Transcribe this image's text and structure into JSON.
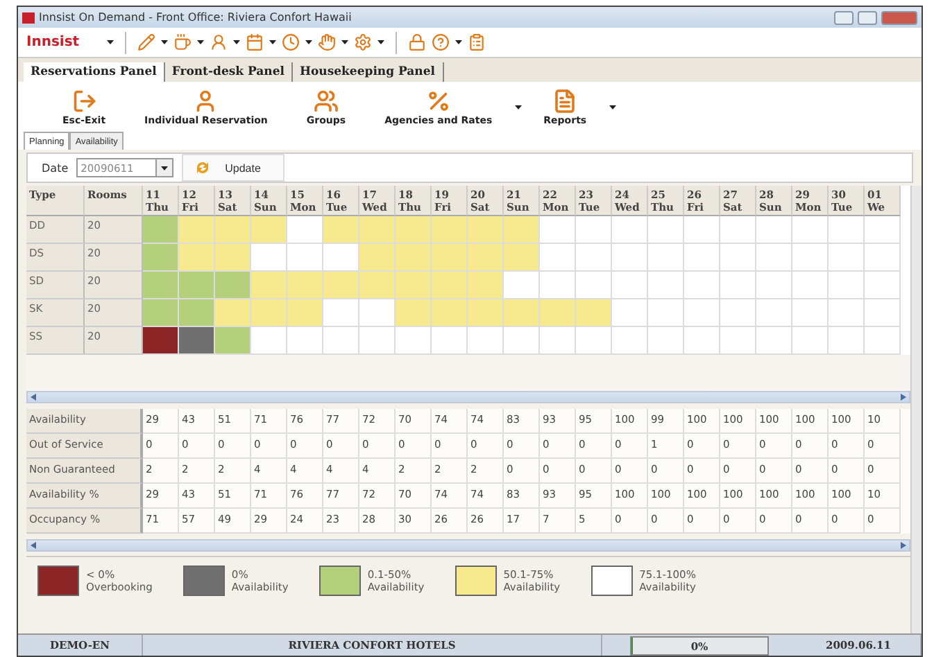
{
  "window": {
    "title": "Innsist On Demand - Front Office: Riviera Confort Hawaii"
  },
  "toolbar": {
    "logo": "Innsist"
  },
  "panel_tabs": [
    {
      "label": "Reservations Panel",
      "selected": true
    },
    {
      "label": "Front-desk Panel",
      "selected": false
    },
    {
      "label": "Housekeeping Panel",
      "selected": false
    }
  ],
  "ribbon": [
    {
      "kind": "exit",
      "label": "Esc-Exit",
      "has_menu": false
    },
    {
      "kind": "person",
      "label": "Individual Reservation",
      "has_menu": false
    },
    {
      "kind": "group",
      "label": "Groups",
      "has_menu": false
    },
    {
      "kind": "rates",
      "label": "Agencies and Rates",
      "has_menu": true
    },
    {
      "kind": "reports",
      "label": "Reports",
      "has_menu": true
    }
  ],
  "sub_tabs": [
    {
      "label": "Planning",
      "selected": true
    },
    {
      "label": "Availability",
      "selected": false
    }
  ],
  "date_bar": {
    "label": "Date",
    "value": "20090611",
    "button": "Update"
  },
  "planning": {
    "type_header": "Type",
    "rooms_header": "Rooms",
    "columns": [
      {
        "day": "11",
        "weekday": "Thu"
      },
      {
        "day": "12",
        "weekday": "Fri"
      },
      {
        "day": "13",
        "weekday": "Sat"
      },
      {
        "day": "14",
        "weekday": "Sun"
      },
      {
        "day": "15",
        "weekday": "Mon"
      },
      {
        "day": "16",
        "weekday": "Tue"
      },
      {
        "day": "17",
        "weekday": "Wed"
      },
      {
        "day": "18",
        "weekday": "Thu"
      },
      {
        "day": "19",
        "weekday": "Fri"
      },
      {
        "day": "20",
        "weekday": "Sat"
      },
      {
        "day": "21",
        "weekday": "Sun"
      },
      {
        "day": "22",
        "weekday": "Mon"
      },
      {
        "day": "23",
        "weekday": "Tue"
      },
      {
        "day": "24",
        "weekday": "Wed"
      },
      {
        "day": "25",
        "weekday": "Thu"
      },
      {
        "day": "26",
        "weekday": "Fri"
      },
      {
        "day": "27",
        "weekday": "Sat"
      },
      {
        "day": "28",
        "weekday": "Sun"
      },
      {
        "day": "29",
        "weekday": "Mon"
      },
      {
        "day": "30",
        "weekday": "Tue"
      },
      {
        "day": "01",
        "weekday": "We"
      }
    ],
    "rows": [
      {
        "type": "DD",
        "rooms": "20",
        "cells": [
          {
            "color": "#b5d07c"
          },
          {
            "color": "#f6e98e"
          },
          {
            "color": "#f6e98e"
          },
          {
            "color": "#f6e98e"
          },
          {
            "color": "#ffffff"
          },
          {
            "color": "#f6e98e"
          },
          {
            "color": "#f6e98e"
          },
          {
            "color": "#f6e98e"
          },
          {
            "color": "#f6e98e"
          },
          {
            "color": "#f6e98e"
          },
          {
            "color": "#f6e98e"
          },
          {
            "color": "#ffffff"
          },
          {
            "color": "#ffffff"
          },
          {
            "color": "#ffffff"
          },
          {
            "color": "#ffffff"
          },
          {
            "color": "#ffffff"
          },
          {
            "color": "#ffffff"
          },
          {
            "color": "#ffffff"
          },
          {
            "color": "#ffffff"
          },
          {
            "color": "#ffffff"
          },
          {
            "color": "#ffffff"
          }
        ]
      },
      {
        "type": "DS",
        "rooms": "20",
        "cells": [
          {
            "color": "#b5d07c"
          },
          {
            "color": "#f6e98e"
          },
          {
            "color": "#f6e98e"
          },
          {
            "color": "#ffffff"
          },
          {
            "color": "#ffffff"
          },
          {
            "color": "#ffffff"
          },
          {
            "color": "#f6e98e"
          },
          {
            "color": "#f6e98e"
          },
          {
            "color": "#f6e98e"
          },
          {
            "color": "#f6e98e"
          },
          {
            "color": "#f6e98e"
          },
          {
            "color": "#ffffff"
          },
          {
            "color": "#ffffff"
          },
          {
            "color": "#ffffff"
          },
          {
            "color": "#ffffff"
          },
          {
            "color": "#ffffff"
          },
          {
            "color": "#ffffff"
          },
          {
            "color": "#ffffff"
          },
          {
            "color": "#ffffff"
          },
          {
            "color": "#ffffff"
          },
          {
            "color": "#ffffff"
          }
        ]
      },
      {
        "type": "SD",
        "rooms": "20",
        "cells": [
          {
            "color": "#b5d07c"
          },
          {
            "color": "#b5d07c"
          },
          {
            "color": "#b5d07c"
          },
          {
            "color": "#f6e98e"
          },
          {
            "color": "#f6e98e"
          },
          {
            "color": "#f6e98e"
          },
          {
            "color": "#f6e98e"
          },
          {
            "color": "#f6e98e"
          },
          {
            "color": "#f6e98e"
          },
          {
            "color": "#f6e98e"
          },
          {
            "color": "#ffffff"
          },
          {
            "color": "#ffffff"
          },
          {
            "color": "#ffffff"
          },
          {
            "color": "#ffffff"
          },
          {
            "color": "#ffffff"
          },
          {
            "color": "#ffffff"
          },
          {
            "color": "#ffffff"
          },
          {
            "color": "#ffffff"
          },
          {
            "color": "#ffffff"
          },
          {
            "color": "#ffffff"
          },
          {
            "color": "#ffffff"
          }
        ]
      },
      {
        "type": "SK",
        "rooms": "20",
        "cells": [
          {
            "color": "#b5d07c"
          },
          {
            "color": "#b5d07c"
          },
          {
            "color": "#f6e98e"
          },
          {
            "color": "#f6e98e"
          },
          {
            "color": "#f6e98e"
          },
          {
            "color": "#ffffff"
          },
          {
            "color": "#ffffff"
          },
          {
            "color": "#f6e98e"
          },
          {
            "color": "#f6e98e"
          },
          {
            "color": "#f6e98e"
          },
          {
            "color": "#f6e98e"
          },
          {
            "color": "#f6e98e"
          },
          {
            "color": "#f6e98e"
          },
          {
            "color": "#ffffff"
          },
          {
            "color": "#ffffff"
          },
          {
            "color": "#ffffff"
          },
          {
            "color": "#ffffff"
          },
          {
            "color": "#ffffff"
          },
          {
            "color": "#ffffff"
          },
          {
            "color": "#ffffff"
          },
          {
            "color": "#ffffff"
          }
        ]
      },
      {
        "type": "SS",
        "rooms": "20",
        "cells": [
          {
            "color": "#8b2526"
          },
          {
            "color": "#707070"
          },
          {
            "color": "#b5d07c"
          },
          {
            "color": "#ffffff"
          },
          {
            "color": "#ffffff"
          },
          {
            "color": "#ffffff"
          },
          {
            "color": "#ffffff"
          },
          {
            "color": "#ffffff"
          },
          {
            "color": "#ffffff"
          },
          {
            "color": "#ffffff"
          },
          {
            "color": "#ffffff"
          },
          {
            "color": "#ffffff"
          },
          {
            "color": "#ffffff"
          },
          {
            "color": "#ffffff"
          },
          {
            "color": "#ffffff"
          },
          {
            "color": "#ffffff"
          },
          {
            "color": "#ffffff"
          },
          {
            "color": "#ffffff"
          },
          {
            "color": "#ffffff"
          },
          {
            "color": "#ffffff"
          },
          {
            "color": "#ffffff"
          }
        ]
      }
    ]
  },
  "statistics": [
    {
      "label": "Availability",
      "values": [
        "29",
        "43",
        "51",
        "71",
        "76",
        "77",
        "72",
        "70",
        "74",
        "74",
        "83",
        "93",
        "95",
        "100",
        "99",
        "100",
        "100",
        "100",
        "100",
        "100",
        "10"
      ]
    },
    {
      "label": "Out of Service",
      "values": [
        "0",
        "0",
        "0",
        "0",
        "0",
        "0",
        "0",
        "0",
        "0",
        "0",
        "0",
        "0",
        "0",
        "0",
        "1",
        "0",
        "0",
        "0",
        "0",
        "0",
        "0"
      ]
    },
    {
      "label": "Non Guaranteed",
      "values": [
        "2",
        "2",
        "2",
        "4",
        "4",
        "4",
        "4",
        "2",
        "2",
        "2",
        "0",
        "0",
        "0",
        "0",
        "0",
        "0",
        "0",
        "0",
        "0",
        "0",
        "0"
      ]
    },
    {
      "label": "Availability %",
      "values": [
        "29",
        "43",
        "51",
        "71",
        "76",
        "77",
        "72",
        "70",
        "74",
        "74",
        "83",
        "93",
        "95",
        "100",
        "100",
        "100",
        "100",
        "100",
        "100",
        "100",
        "10"
      ]
    },
    {
      "label": "Occupancy %",
      "values": [
        "71",
        "57",
        "49",
        "29",
        "24",
        "23",
        "28",
        "30",
        "26",
        "26",
        "17",
        "7",
        "5",
        "0",
        "0",
        "0",
        "0",
        "0",
        "0",
        "0",
        "0"
      ]
    }
  ],
  "legend": [
    {
      "color": "#8b2526",
      "range": "< 0%",
      "label": "Overbooking"
    },
    {
      "color": "#707070",
      "range": "0%",
      "label": "Availability"
    },
    {
      "color": "#b5d07c",
      "range": "0.1-50%",
      "label": "Availability"
    },
    {
      "color": "#f6e98e",
      "range": "50.1-75%",
      "label": "Availability"
    },
    {
      "color": "#ffffff",
      "range": "75.1-100%",
      "label": "Availability"
    }
  ],
  "status_bar": {
    "user": "DEMO-EN",
    "hotel": "RIVIERA CONFORT HOTELS",
    "progress": {
      "text": "0%",
      "level": 0
    },
    "date": "2009.06.11"
  }
}
